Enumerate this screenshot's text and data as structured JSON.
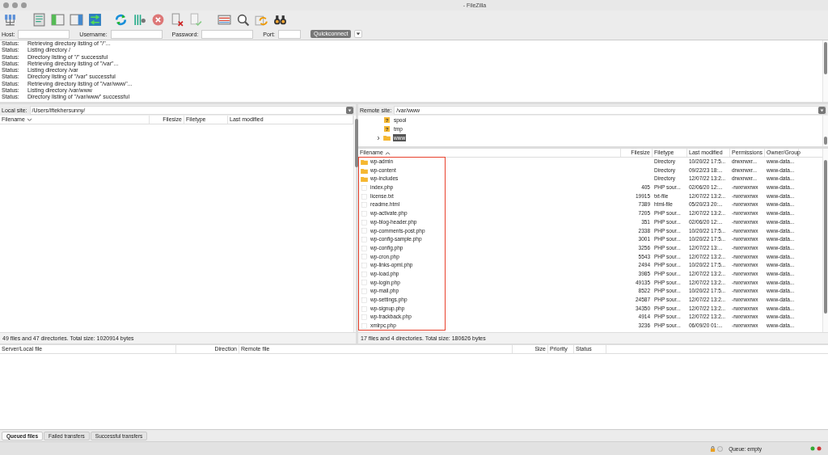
{
  "window": {
    "title": "- FileZilla"
  },
  "quickconnect": {
    "fields": [
      {
        "label": "Host:"
      },
      {
        "label": "Username:"
      },
      {
        "label": "Password:"
      },
      {
        "label": "Port:"
      }
    ],
    "button": "Quickconnect"
  },
  "log": [
    {
      "type": "Status:",
      "message": "Retrieving directory listing of \"/\"..."
    },
    {
      "type": "Status:",
      "message": "Listing directory /"
    },
    {
      "type": "Status:",
      "message": "Directory listing of \"/\" successful"
    },
    {
      "type": "Status:",
      "message": "Retrieving directory listing of \"/var\"..."
    },
    {
      "type": "Status:",
      "message": "Listing directory /var"
    },
    {
      "type": "Status:",
      "message": "Directory listing of \"/var\" successful"
    },
    {
      "type": "Status:",
      "message": "Retrieving directory listing of \"/var/www\"..."
    },
    {
      "type": "Status:",
      "message": "Listing directory /var/www"
    },
    {
      "type": "Status:",
      "message": "Directory listing of \"/var/www\" successful"
    }
  ],
  "local": {
    "site_label": "Local site:",
    "path": "/Users/iftekhersunny/",
    "columns": [
      "Filename",
      "Filesize",
      "Filetype",
      "Last modified"
    ],
    "status": "49 files and 47 directories. Total size: 1020914 bytes"
  },
  "remote": {
    "site_label": "Remote site:",
    "path": "/var/www",
    "tree": [
      {
        "name": "spool",
        "kind": "unknown",
        "icon": "?",
        "selected": false
      },
      {
        "name": "tmp",
        "kind": "unknown",
        "icon": "?",
        "selected": false
      },
      {
        "name": "www",
        "kind": "folder",
        "selected": true
      }
    ],
    "columns": [
      "Filename",
      "Filesize",
      "Filetype",
      "Last modified",
      "Permissions",
      "Owner/Group"
    ],
    "rows": [
      {
        "kind": "folder",
        "name": "wp-admin",
        "size": "",
        "type": "Directory",
        "modified": "10/20/22 17:5...",
        "permissions": "drwxrwxr...",
        "owner": "www-data..."
      },
      {
        "kind": "folder",
        "name": "wp-content",
        "size": "",
        "type": "Directory",
        "modified": "09/22/23 18:...",
        "permissions": "drwxrwxr...",
        "owner": "www-data..."
      },
      {
        "kind": "folder",
        "name": "wp-includes",
        "size": "",
        "type": "Directory",
        "modified": "12/07/22 13:2...",
        "permissions": "drwxrwxr...",
        "owner": "www-data..."
      },
      {
        "kind": "file",
        "name": "index.php",
        "size": "405",
        "type": "PHP sour...",
        "modified": "02/06/20 12:...",
        "permissions": "-rwxrwxrwx",
        "owner": "www-data..."
      },
      {
        "kind": "file",
        "name": "license.txt",
        "size": "19915",
        "type": "txt-file",
        "modified": "12/07/22 13:2...",
        "permissions": "-rwxrwxrwx",
        "owner": "www-data..."
      },
      {
        "kind": "file",
        "name": "readme.html",
        "size": "7389",
        "type": "html-file",
        "modified": "05/20/23 20:...",
        "permissions": "-rwxrwxrwx",
        "owner": "www-data..."
      },
      {
        "kind": "file",
        "name": "wp-activate.php",
        "size": "7205",
        "type": "PHP sour...",
        "modified": "12/07/22 13:2...",
        "permissions": "-rwxrwxrwx",
        "owner": "www-data..."
      },
      {
        "kind": "file",
        "name": "wp-blog-header.php",
        "size": "351",
        "type": "PHP sour...",
        "modified": "02/06/20 12:...",
        "permissions": "-rwxrwxrwx",
        "owner": "www-data..."
      },
      {
        "kind": "file",
        "name": "wp-comments-post.php",
        "size": "2338",
        "type": "PHP sour...",
        "modified": "10/20/22 17:5...",
        "permissions": "-rwxrwxrwx",
        "owner": "www-data..."
      },
      {
        "kind": "file",
        "name": "wp-config-sample.php",
        "size": "3001",
        "type": "PHP sour...",
        "modified": "10/20/22 17:5...",
        "permissions": "-rwxrwxrwx",
        "owner": "www-data..."
      },
      {
        "kind": "file",
        "name": "wp-config.php",
        "size": "3256",
        "type": "PHP sour...",
        "modified": "12/07/22 13:...",
        "permissions": "-rwxrwxrwx",
        "owner": "www-data..."
      },
      {
        "kind": "file",
        "name": "wp-cron.php",
        "size": "5543",
        "type": "PHP sour...",
        "modified": "12/07/22 13:2...",
        "permissions": "-rwxrwxrwx",
        "owner": "www-data..."
      },
      {
        "kind": "file",
        "name": "wp-links-opml.php",
        "size": "2494",
        "type": "PHP sour...",
        "modified": "10/20/22 17:5...",
        "permissions": "-rwxrwxrwx",
        "owner": "www-data..."
      },
      {
        "kind": "file",
        "name": "wp-load.php",
        "size": "3985",
        "type": "PHP sour...",
        "modified": "12/07/22 13:2...",
        "permissions": "-rwxrwxrwx",
        "owner": "www-data..."
      },
      {
        "kind": "file",
        "name": "wp-login.php",
        "size": "49135",
        "type": "PHP sour...",
        "modified": "12/07/22 13:2...",
        "permissions": "-rwxrwxrwx",
        "owner": "www-data..."
      },
      {
        "kind": "file",
        "name": "wp-mail.php",
        "size": "8522",
        "type": "PHP sour...",
        "modified": "10/20/22 17:5...",
        "permissions": "-rwxrwxrwx",
        "owner": "www-data..."
      },
      {
        "kind": "file",
        "name": "wp-settings.php",
        "size": "24587",
        "type": "PHP sour...",
        "modified": "12/07/22 13:2...",
        "permissions": "-rwxrwxrwx",
        "owner": "www-data..."
      },
      {
        "kind": "file",
        "name": "wp-signup.php",
        "size": "34350",
        "type": "PHP sour...",
        "modified": "12/07/22 13:2...",
        "permissions": "-rwxrwxrwx",
        "owner": "www-data..."
      },
      {
        "kind": "file",
        "name": "wp-trackback.php",
        "size": "4914",
        "type": "PHP sour...",
        "modified": "12/07/22 13:2...",
        "permissions": "-rwxrwxrwx",
        "owner": "www-data..."
      },
      {
        "kind": "file",
        "name": "xmlrpc.php",
        "size": "3236",
        "type": "PHP sour...",
        "modified": "06/09/20 01:...",
        "permissions": "-rwxrwxrwx",
        "owner": "www-data..."
      }
    ],
    "status": "17 files and 4 directories. Total size: 180626 bytes"
  },
  "queue": {
    "columns": [
      "Server/Local file",
      "Direction",
      "Remote file",
      "Size",
      "Priority",
      "Status"
    ]
  },
  "queue_tabs": [
    {
      "label": "Queued files",
      "selected": true
    },
    {
      "label": "Failed transfers",
      "selected": false
    },
    {
      "label": "Successful transfers",
      "selected": false
    }
  ],
  "status_bar": {
    "queue": "Queue: empty"
  }
}
